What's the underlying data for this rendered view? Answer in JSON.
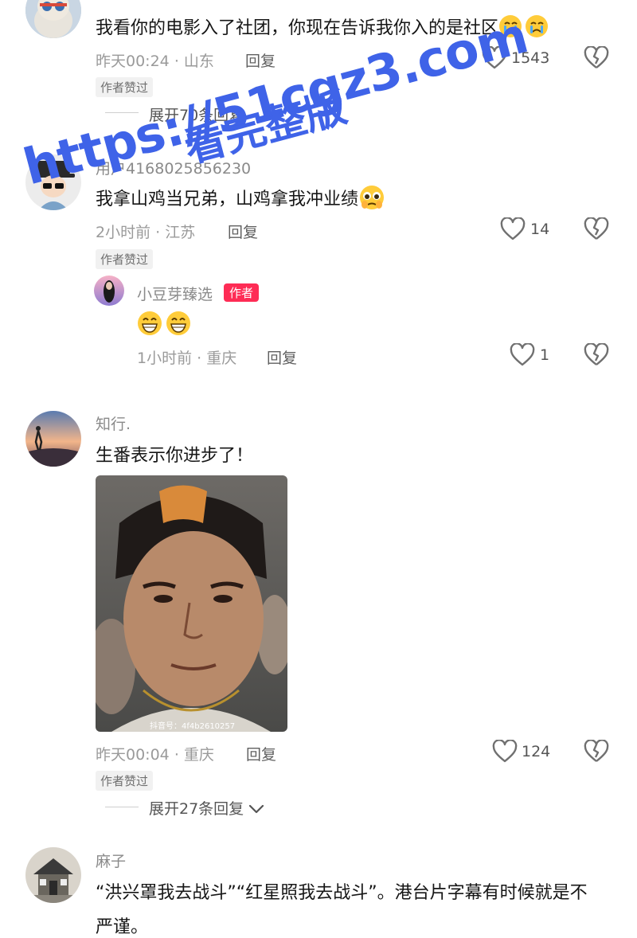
{
  "comments": [
    {
      "text": "我看你的电影入了社团，你现在告诉我你入的是社区",
      "time": "昨天00:24",
      "location": "山东",
      "reply_label": "回复",
      "likes": "1543",
      "author_liked": "作者赞过",
      "expand_label": "展开70条回复"
    },
    {
      "username": "用户4168025856230",
      "text": "我拿山鸡当兄弟，山鸡拿我冲业绩",
      "time": "2小时前",
      "location": "江苏",
      "reply_label": "回复",
      "likes": "14",
      "author_liked": "作者赞过",
      "sub_reply": {
        "username": "小豆芽臻选",
        "author_tag": "作者",
        "time": "1小时前",
        "location": "重庆",
        "reply_label": "回复",
        "likes": "1"
      }
    },
    {
      "username": "知行.",
      "text": "生番表示你进步了！",
      "image_caption": "抖音号：4f4b2610257",
      "time": "昨天00:04",
      "location": "重庆",
      "reply_label": "回复",
      "likes": "124",
      "author_liked": "作者赞过",
      "expand_label": "展开27条回复"
    },
    {
      "username": "麻子",
      "text_line1": "“洪兴罩我去战斗”“红星照我去战斗”。港台片字幕有时候就是不",
      "text_line2": "严谨。"
    }
  ],
  "watermark": {
    "line1": "https://51cgz3.com",
    "line2": "看完整版"
  },
  "separator": "·",
  "icons": [
    "heart-icon",
    "broken-heart-icon",
    "chevron-down-icon"
  ],
  "colors": {
    "accent": "#fe2c55",
    "watermark": "#3f63e8",
    "muted": "#9a9a9a"
  }
}
